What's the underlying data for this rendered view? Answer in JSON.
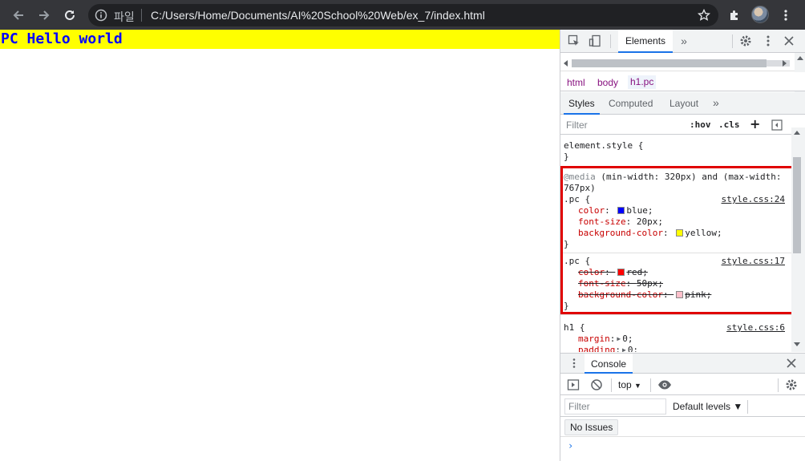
{
  "browser": {
    "scheme_label": "파일",
    "url": "C:/Users/Home/Documents/AI%20School%20Web/ex_7/index.html"
  },
  "page": {
    "heading": "PC Hello world"
  },
  "devtools": {
    "tabs": {
      "elements": "Elements",
      "more": "»"
    },
    "breadcrumbs": [
      "html",
      "body",
      "h1.pc"
    ],
    "subtabs": [
      "Styles",
      "Computed",
      "Layout",
      "»"
    ],
    "filter": {
      "placeholder": "Filter",
      "hov": ":hov",
      "cls": ".cls",
      "add": "+"
    },
    "styles": {
      "element_style_open": "element.style {",
      "close": "}",
      "media_keyword": "@media",
      "media_query_1": " (min-width: 320px) and (max-width:",
      "media_query_2": "767px)",
      "rule1": {
        "selector": ".pc {",
        "source": "style.css:24",
        "props": [
          {
            "name": "color",
            "value": "blue;",
            "swatch": "#0000ff"
          },
          {
            "name": "font-size",
            "value": "20px;"
          },
          {
            "name": "background-color",
            "value": "yellow;",
            "swatch": "#ffff00"
          }
        ]
      },
      "rule2": {
        "selector": ".pc {",
        "source": "style.css:17",
        "props": [
          {
            "name": "color",
            "value": "red;",
            "swatch": "#ff0000"
          },
          {
            "name": "font-size",
            "value": "50px;"
          },
          {
            "name": "background-color",
            "value": "pink;",
            "swatch": "#ffc0cb"
          }
        ]
      },
      "rule3": {
        "selector": "h1 {",
        "source": "style.css:6",
        "props": [
          {
            "name": "margin",
            "value": "0;"
          },
          {
            "name": "padding",
            "value": "0;"
          }
        ]
      }
    },
    "console": {
      "tab": "Console",
      "context": "top",
      "filter_placeholder": "Filter",
      "levels": "Default levels ▼",
      "no_issues": "No Issues",
      "prompt": "›"
    }
  },
  "colors": {
    "highlight": "#e00000",
    "accent": "#1a73e8"
  }
}
